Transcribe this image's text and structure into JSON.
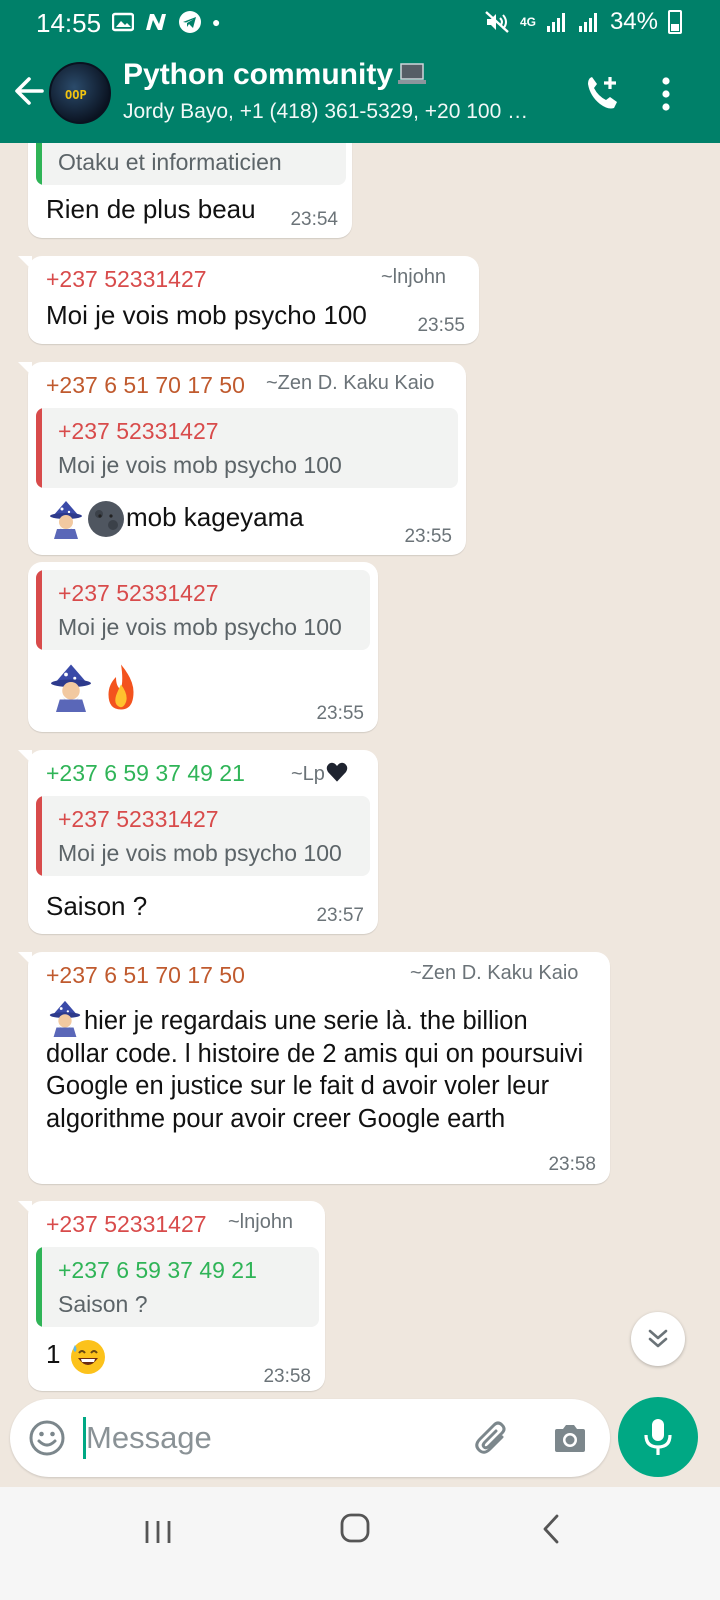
{
  "status_bar": {
    "time": "14:55",
    "battery": "34%",
    "network": "4G"
  },
  "header": {
    "title": "Python community",
    "title_icon": "laptop-icon",
    "avatar_text": "OOP",
    "subtitle": "Jordy Bayo, +1 (418) 361-5329, +20 100 …"
  },
  "messages": [
    {
      "quote": {
        "text": "Otaku et informaticien",
        "bar_color": "#2fb457"
      },
      "text": "Rien de plus beau",
      "time": "23:54"
    },
    {
      "sender": "+237 52331427",
      "alias": "~lnjohn",
      "text": "Moi je vois mob psycho 100",
      "time": "23:55"
    },
    {
      "sender": "+237 6 51 70 17 50",
      "alias": "~Zen D. Kaku Kaio",
      "quote": {
        "sender": "+237 52331427",
        "text": "Moi je vois mob psycho 100"
      },
      "emojis": [
        "mage-emoji",
        "new-moon-face-emoji"
      ],
      "text": "mob kageyama",
      "time": "23:55"
    },
    {
      "quote": {
        "sender": "+237 52331427",
        "text": "Moi je vois mob psycho 100"
      },
      "emojis": [
        "mage-emoji",
        "fire-emoji"
      ],
      "time": "23:55"
    },
    {
      "sender": "+237 6 59 37 49 21",
      "alias": "~Lp",
      "alias_emoji": "black-heart-emoji",
      "quote": {
        "sender": "+237 52331427",
        "text": "Moi je vois mob psycho 100"
      },
      "text": "Saison ?",
      "time": "23:57"
    },
    {
      "sender": "+237 6 51 70 17 50",
      "alias": "~Zen D. Kaku Kaio",
      "emojis": [
        "mage-emoji"
      ],
      "text": "hier je regardais une serie là. the billion dollar code. l histoire de 2 amis qui on poursuivi Google en justice sur le fait d avoir voler leur algorithme pour avoir creer Google earth",
      "time": "23:58"
    },
    {
      "sender": "+237 52331427",
      "alias": "~lnjohn",
      "quote": {
        "sender": "+237 6 59 37 49 21",
        "text": "Saison ?"
      },
      "text": "1",
      "emojis": [
        "sweat-smile-emoji"
      ],
      "time": "23:58"
    }
  ],
  "composer": {
    "placeholder": "Message"
  },
  "colors": {
    "header_bg": "#008069",
    "accent": "#00a884",
    "chat_bg": "#efe7de",
    "sender_red": "#d84b4b",
    "sender_brown": "#c05a2e",
    "sender_green": "#2fb457"
  }
}
